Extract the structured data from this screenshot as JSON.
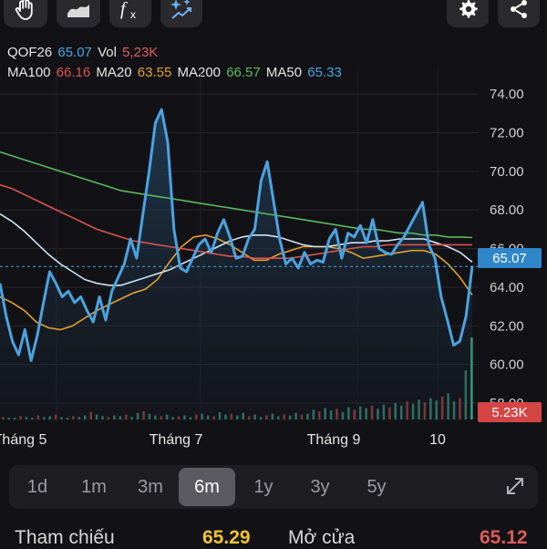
{
  "toolbar": {
    "left_icons": [
      "hand-icon",
      "area-chart-icon",
      "function-icon",
      "sparkle-chart-icon"
    ],
    "right_icons": [
      "gear-icon",
      "share-icon"
    ]
  },
  "header": {
    "symbol": "QOF26",
    "price": "65.07",
    "vol_label": "Vol",
    "vol_value": "5,23K",
    "ma100_label": "MA100",
    "ma100_value": "66.16",
    "ma20_label": "MA20",
    "ma20_value": "63.55",
    "ma200_label": "MA200",
    "ma200_value": "66.57",
    "ma50_label": "MA50",
    "ma50_value": "65.33"
  },
  "colors": {
    "price": "#4aa3e0",
    "vol": "#e05a5a",
    "ma100": "#d9534f",
    "ma20": "#e0a030",
    "ma200": "#5cb85c",
    "ma50": "#4aa3e0",
    "tag_price": "#2f86c9",
    "tag_vol": "#d64545"
  },
  "price_tag": "65.07",
  "vol_tag": "5.23K",
  "chart_data": {
    "type": "line",
    "ylim": [
      58,
      75
    ],
    "yticks": [
      "74.00",
      "72.00",
      "70.00",
      "68.00",
      "66.00",
      "64.00",
      "62.00",
      "60.00",
      "58.00"
    ],
    "xticks": [
      "Tháng 5",
      "Tháng 7",
      "Tháng 9",
      "10"
    ],
    "last_price": 65.07,
    "series": [
      {
        "name": "QOF26",
        "values": [
          64.2,
          62.5,
          61.2,
          60.5,
          61.8,
          60.2,
          61.5,
          63.2,
          64.8,
          64.2,
          63.5,
          63.8,
          63.2,
          63.5,
          62.8,
          62.2,
          63.5,
          62.3,
          63.8,
          64.5,
          65.2,
          66.5,
          65.5,
          67.8,
          70.0,
          72.5,
          73.2,
          71.5,
          67.0,
          65.0,
          64.8,
          65.5,
          66.2,
          66.5,
          65.8,
          66.8,
          67.5,
          66.6,
          65.5,
          65.6,
          66.5,
          67.0,
          69.5,
          70.5,
          68.5,
          66.5,
          65.2,
          65.5,
          65.0,
          65.8,
          65.2,
          65.4,
          65.3,
          66.5,
          67.0,
          65.5,
          66.8,
          66.6,
          67.2,
          66.3,
          67.5,
          66.0,
          65.8,
          65.7,
          66.2,
          66.6,
          67.2,
          67.8,
          68.4,
          66.2,
          65.5,
          63.5,
          62.3,
          61.0,
          61.2,
          62.5,
          65.1
        ]
      },
      {
        "name": "MA20",
        "values": [
          63.5,
          63.2,
          62.8,
          62.2,
          61.9,
          61.8,
          62.0,
          62.4,
          62.8,
          63.1,
          63.4,
          63.7,
          63.9,
          64.4,
          65.3,
          66.1,
          66.6,
          66.7,
          66.5,
          66.2,
          65.8,
          65.4,
          65.4,
          65.7,
          65.9,
          66.1,
          66.1,
          66.1,
          66.0,
          65.8,
          65.5,
          65.6,
          65.7,
          65.8,
          65.9,
          65.9,
          65.7,
          65.2,
          64.5,
          63.6
        ]
      },
      {
        "name": "MA50",
        "values": [
          67.8,
          67.4,
          66.9,
          66.3,
          65.7,
          65.2,
          64.8,
          64.4,
          64.2,
          64.1,
          64.1,
          64.3,
          64.5,
          64.7,
          64.9,
          65.2,
          65.5,
          65.8,
          66.1,
          66.4,
          66.6,
          66.7,
          66.7,
          66.6,
          66.4,
          66.2,
          66.1,
          66.1,
          66.2,
          66.3,
          66.3,
          66.4,
          66.4,
          66.5,
          66.5,
          66.5,
          66.3,
          66.1,
          65.8,
          65.3
        ]
      },
      {
        "name": "MA100",
        "values": [
          69.3,
          69.1,
          68.8,
          68.5,
          68.2,
          67.9,
          67.6,
          67.3,
          67.0,
          66.8,
          66.6,
          66.4,
          66.3,
          66.2,
          66.1,
          66.0,
          65.9,
          65.8,
          65.7,
          65.6,
          65.6,
          65.5,
          65.5,
          65.5,
          65.5,
          65.6,
          65.7,
          65.8,
          65.9,
          66.0,
          66.1,
          66.1,
          66.2,
          66.2,
          66.2,
          66.2,
          66.2,
          66.2,
          66.2,
          66.2
        ]
      },
      {
        "name": "MA200",
        "values": [
          71.0,
          70.8,
          70.6,
          70.4,
          70.2,
          70.0,
          69.8,
          69.6,
          69.4,
          69.2,
          69.0,
          68.9,
          68.8,
          68.7,
          68.6,
          68.5,
          68.4,
          68.3,
          68.2,
          68.1,
          68.0,
          67.9,
          67.8,
          67.7,
          67.6,
          67.5,
          67.4,
          67.3,
          67.2,
          67.1,
          67.0,
          67.0,
          66.9,
          66.8,
          66.8,
          66.7,
          66.7,
          66.6,
          66.6,
          66.57
        ]
      }
    ],
    "volume": [
      3,
      2,
      2,
      4,
      3,
      2,
      5,
      3,
      4,
      6,
      3,
      2,
      4,
      3,
      5,
      9,
      6,
      4,
      3,
      5,
      4,
      6,
      3,
      8,
      10,
      7,
      5,
      4,
      6,
      3,
      4,
      5,
      3,
      6,
      7,
      5,
      4,
      9,
      6,
      7,
      5,
      8,
      4,
      6,
      3,
      5,
      7,
      4,
      6,
      5,
      8,
      6,
      7,
      12,
      10,
      14,
      11,
      13,
      9,
      15,
      12,
      16,
      14,
      17,
      13,
      18,
      15,
      20,
      17,
      22,
      19,
      24,
      21,
      26,
      23,
      28,
      32,
      22,
      26,
      60,
      100
    ]
  },
  "timeframes": {
    "items": [
      "1d",
      "1m",
      "3m",
      "6m",
      "1y",
      "3y",
      "5y"
    ],
    "active": "6m"
  },
  "bottom": {
    "ref_label": "Tham chiếu",
    "ref_value": "65.29",
    "open_label": "Mở cửa",
    "open_value": "65.12"
  }
}
